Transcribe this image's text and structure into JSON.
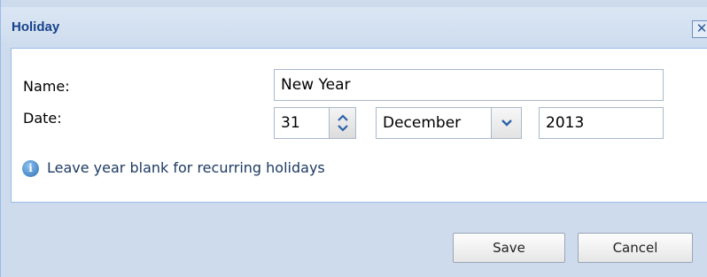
{
  "window": {
    "title": "Holiday",
    "close_symbol": "✕"
  },
  "form": {
    "name_label": "Name:",
    "name_value": "New Year",
    "date_label": "Date:",
    "day_value": "31",
    "month_value": "December",
    "year_value": "2013"
  },
  "info": {
    "icon": "info-icon",
    "text": "Leave year blank for recurring holidays"
  },
  "buttons": {
    "save_label": "Save",
    "cancel_label": "Cancel"
  },
  "colors": {
    "title_text": "#15428b",
    "panel_background": "#cddbec",
    "border": "#99bbe8"
  }
}
